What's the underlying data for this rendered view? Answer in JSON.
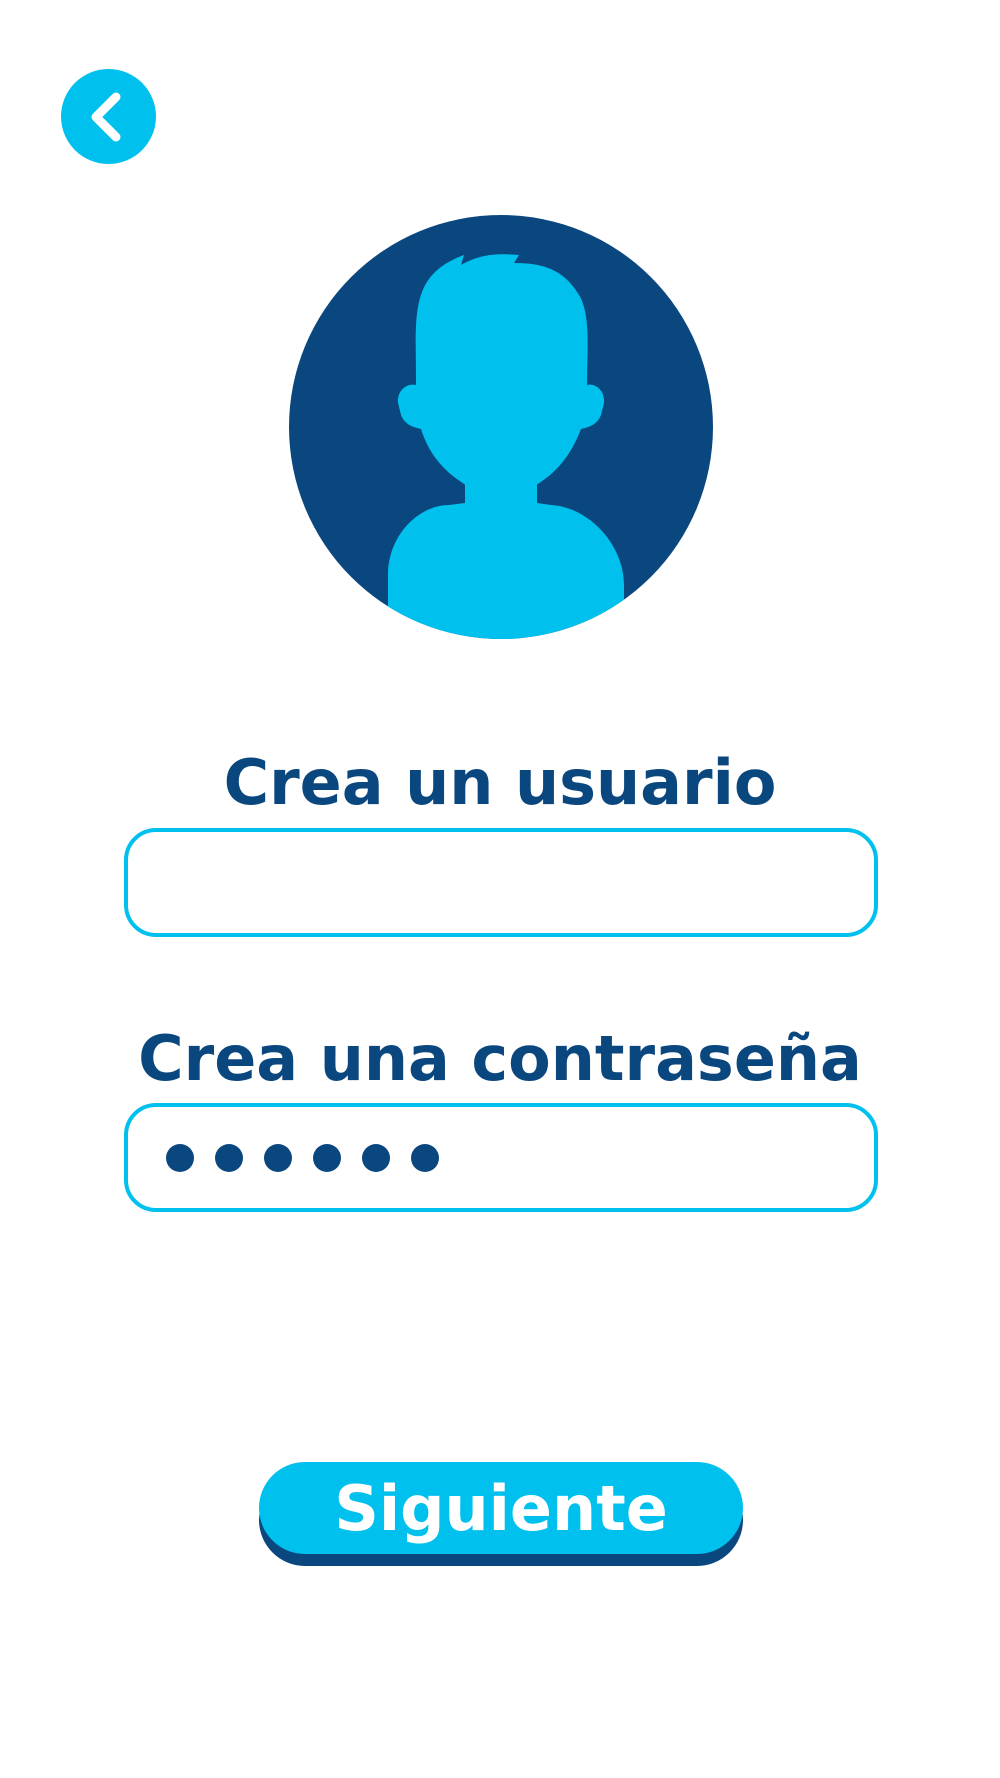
{
  "colors": {
    "accent": "#00c0ee",
    "primary": "#0b477f",
    "background": "#ffffff"
  },
  "header": {
    "back_icon": "chevron-left-icon"
  },
  "avatar": {
    "icon": "user-silhouette-icon"
  },
  "form": {
    "username_label": "Crea un usuario",
    "username_value": "",
    "password_label": "Crea una contraseña",
    "password_masked_count": 6
  },
  "footer": {
    "next_label": "Siguiente"
  }
}
